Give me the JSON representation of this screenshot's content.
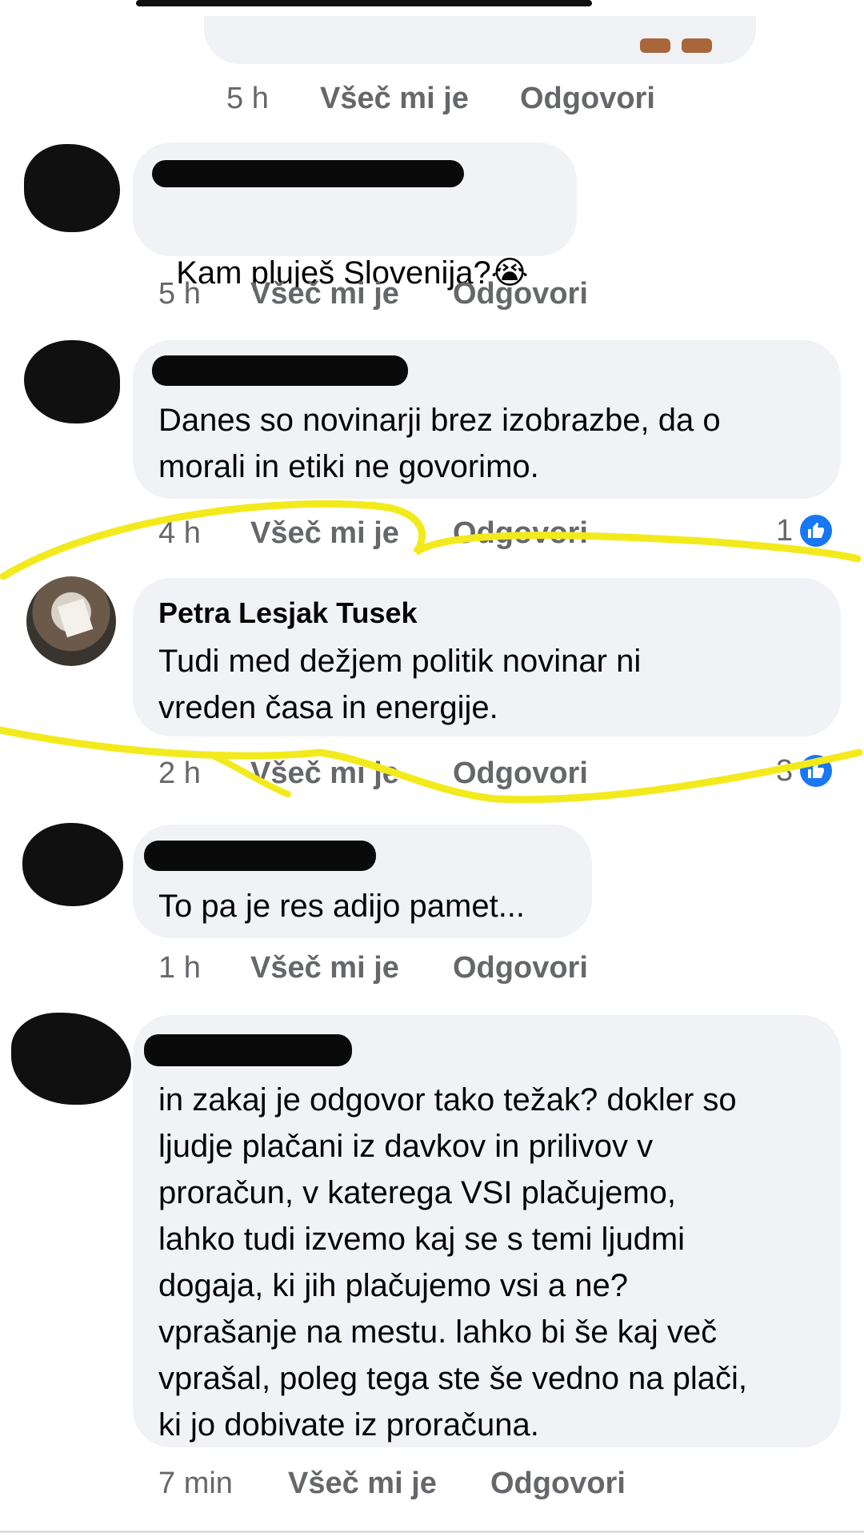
{
  "comments": [
    {
      "time": "5 h",
      "like": "Všeč mi je",
      "reply": "Odgovori"
    },
    {
      "text": "Kam pluješ Slovenija?",
      "emoji": "😭",
      "time": "5 h",
      "like": "Všeč mi je",
      "reply": "Odgovori"
    },
    {
      "text": "Danes so novinarji brez izobrazbe, da o\nmorali in etiki ne govorimo.",
      "time": "4 h",
      "like": "Všeč mi je",
      "reply": "Odgovori",
      "reactions": "1"
    },
    {
      "author": "Petra Lesjak Tusek",
      "text": "Tudi med dežjem politik novinar ni\nvreden časa in energije.",
      "time": "2 h",
      "like": "Všeč mi je",
      "reply": "Odgovori",
      "reactions": "3"
    },
    {
      "text": "To pa je res adijo pamet...",
      "time": "1 h",
      "like": "Všeč mi je",
      "reply": "Odgovori"
    },
    {
      "text": "in zakaj je odgovor tako težak? dokler so\nljudje plačani iz davkov in prilivov v\nproračun, v katerega VSI plačujemo,\nlahko tudi izvemo kaj se s temi ljudmi\ndogaja, ki jih plačujemo vsi a ne?\nvprašanje na mestu. lahko bi še kaj več\nvprašal, poleg tega ste še vedno na plači,\nki jo dobivate iz proračuna.",
      "time": "7 min",
      "like": "Všeč mi je",
      "reply": "Odgovori"
    }
  ],
  "colors": {
    "bubble": "#f0f2f5",
    "meta_text": "#65676b",
    "like_blue": "#1877f2",
    "highlight": "#f2ea1c"
  },
  "icons": [
    "like-thumb-icon",
    "crying-emoji-icon"
  ]
}
